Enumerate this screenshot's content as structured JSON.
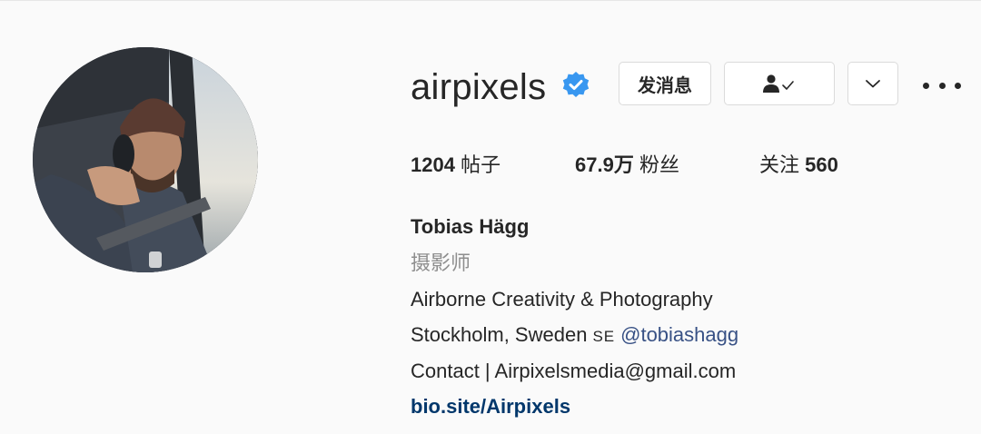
{
  "profile": {
    "username": "airpixels",
    "verified": true,
    "buttons": {
      "message_label": "发消息",
      "following_icon": "person-check-icon",
      "dropdown_icon": "chevron-down-icon",
      "more_icon": "more-horizontal-icon"
    },
    "stats": {
      "posts_value": "1204",
      "posts_label": "帖子",
      "followers_value": "67.9万",
      "followers_label": "粉丝",
      "following_label": "关注",
      "following_value": "560"
    },
    "bio": {
      "full_name": "Tobias Hägg",
      "category": "摄影师",
      "line1": "Airborne Creativity & Photography",
      "line2_text": "Stockholm, Sweden",
      "line2_country": "SE",
      "line2_mention": "@tobiashagg",
      "line3": "Contact | Airpixelsmedia@gmail.com",
      "link": "bio.site/Airpixels"
    }
  },
  "colors": {
    "background": "#fafafa",
    "verified_badge": "#3897f0",
    "text_primary": "#262626",
    "text_secondary": "#8e8e8e",
    "mention": "#385185",
    "link": "#00376b",
    "border": "#dbdbdb"
  }
}
